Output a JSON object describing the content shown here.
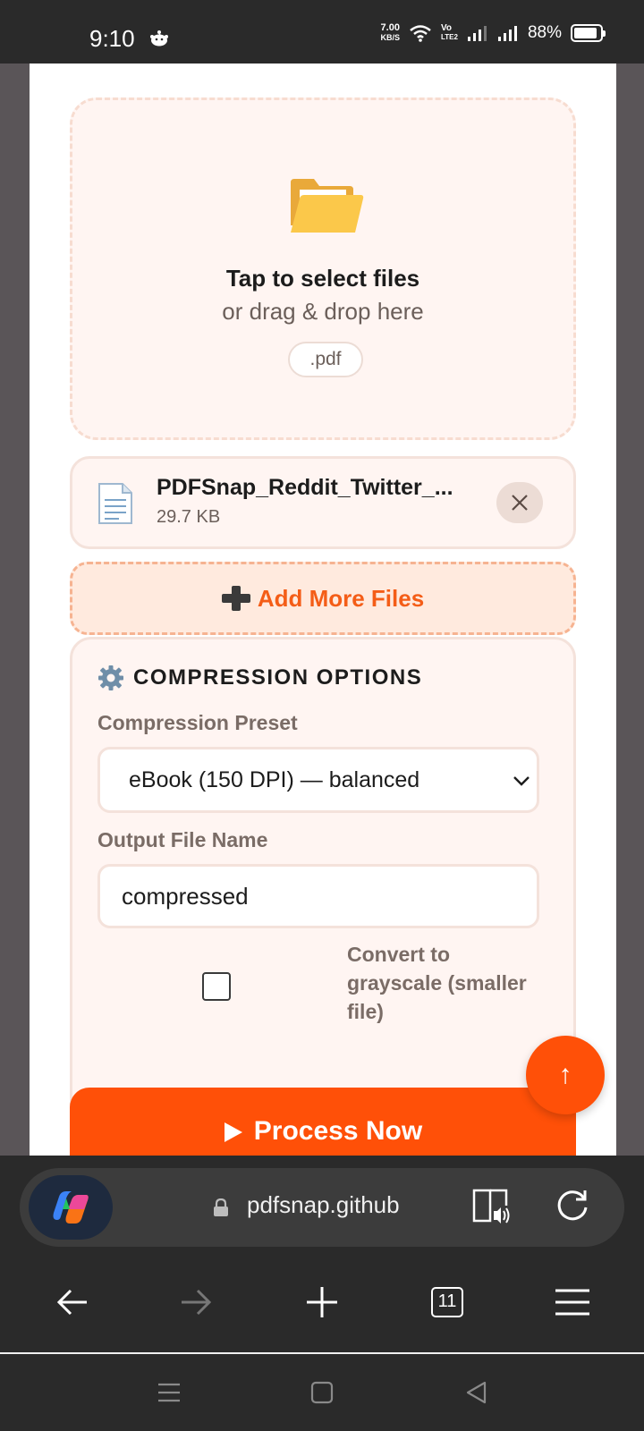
{
  "status_bar": {
    "time": "9:10",
    "net_speed_value": "7.00",
    "net_speed_unit": "KB/S",
    "volte_top": "Vo",
    "volte_bottom": "LTE2",
    "battery_percent": "88%",
    "battery_level": 0.88
  },
  "dropzone": {
    "title": "Tap to select files",
    "subtitle": "or drag & drop here",
    "accepted_ext": ".pdf",
    "icon": "folder-icon"
  },
  "file": {
    "name": "PDFSnap_Reddit_Twitter_...",
    "size": "29.7 KB",
    "icon": "document-icon"
  },
  "add_more": {
    "label": "Add More Files",
    "icon": "plus-icon"
  },
  "options": {
    "title": "COMPRESSION OPTIONS",
    "icon": "gear-icon",
    "preset_label": "Compression Preset",
    "preset_value": "eBook (150 DPI) — balanced",
    "filename_label": "Output File Name",
    "filename_value": "compressed",
    "grayscale_label": "Convert to grayscale (smaller file)",
    "grayscale_checked": false
  },
  "process": {
    "label": "Process Now",
    "icon": "play-icon"
  },
  "scroll_top": {
    "glyph": "↑"
  },
  "browser": {
    "url": "pdfsnap.github",
    "tab_count": "11"
  },
  "colors": {
    "accent": "#ff5008",
    "accent_text": "#f45d17",
    "card_bg": "#fff5f2",
    "label_gray": "#7a6c66"
  }
}
